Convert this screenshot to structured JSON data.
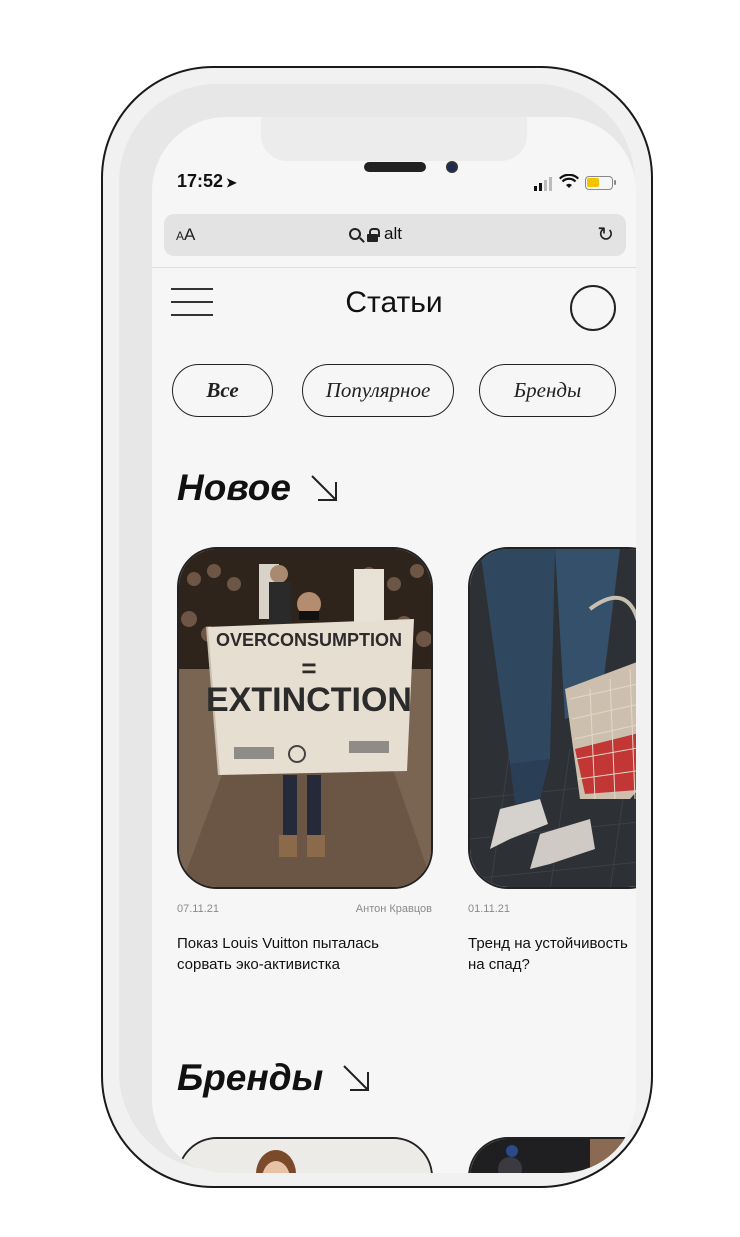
{
  "status_bar": {
    "time": "17:52",
    "location_icon": "➤"
  },
  "browser": {
    "text_size_small": "A",
    "text_size_large": "A",
    "url": "alt",
    "reload_icon": "↻"
  },
  "header": {
    "title": "Статьи"
  },
  "filters": [
    {
      "label": "Все",
      "active": true
    },
    {
      "label": "Популярное",
      "active": false
    },
    {
      "label": "Бренды",
      "active": false
    }
  ],
  "sections": {
    "new": {
      "title": "Новое",
      "articles": [
        {
          "date": "07.11.21",
          "author": "Антон Кравцов",
          "title": "Показ Louis Vuitton пыталась сорвать эко-активистка",
          "banner_line1": "OVERCONSUMPTION",
          "banner_line2": "=",
          "banner_line3": "EXTINCTION"
        },
        {
          "date": "01.11.21",
          "author": "",
          "title": "Тренд на устойчивость на спад?"
        }
      ]
    },
    "brands": {
      "title": "Бренды"
    }
  },
  "colors": {
    "screen_bg": "#f6f6f6",
    "text": "#111111",
    "border": "#222222",
    "battery": "#f5c400"
  }
}
